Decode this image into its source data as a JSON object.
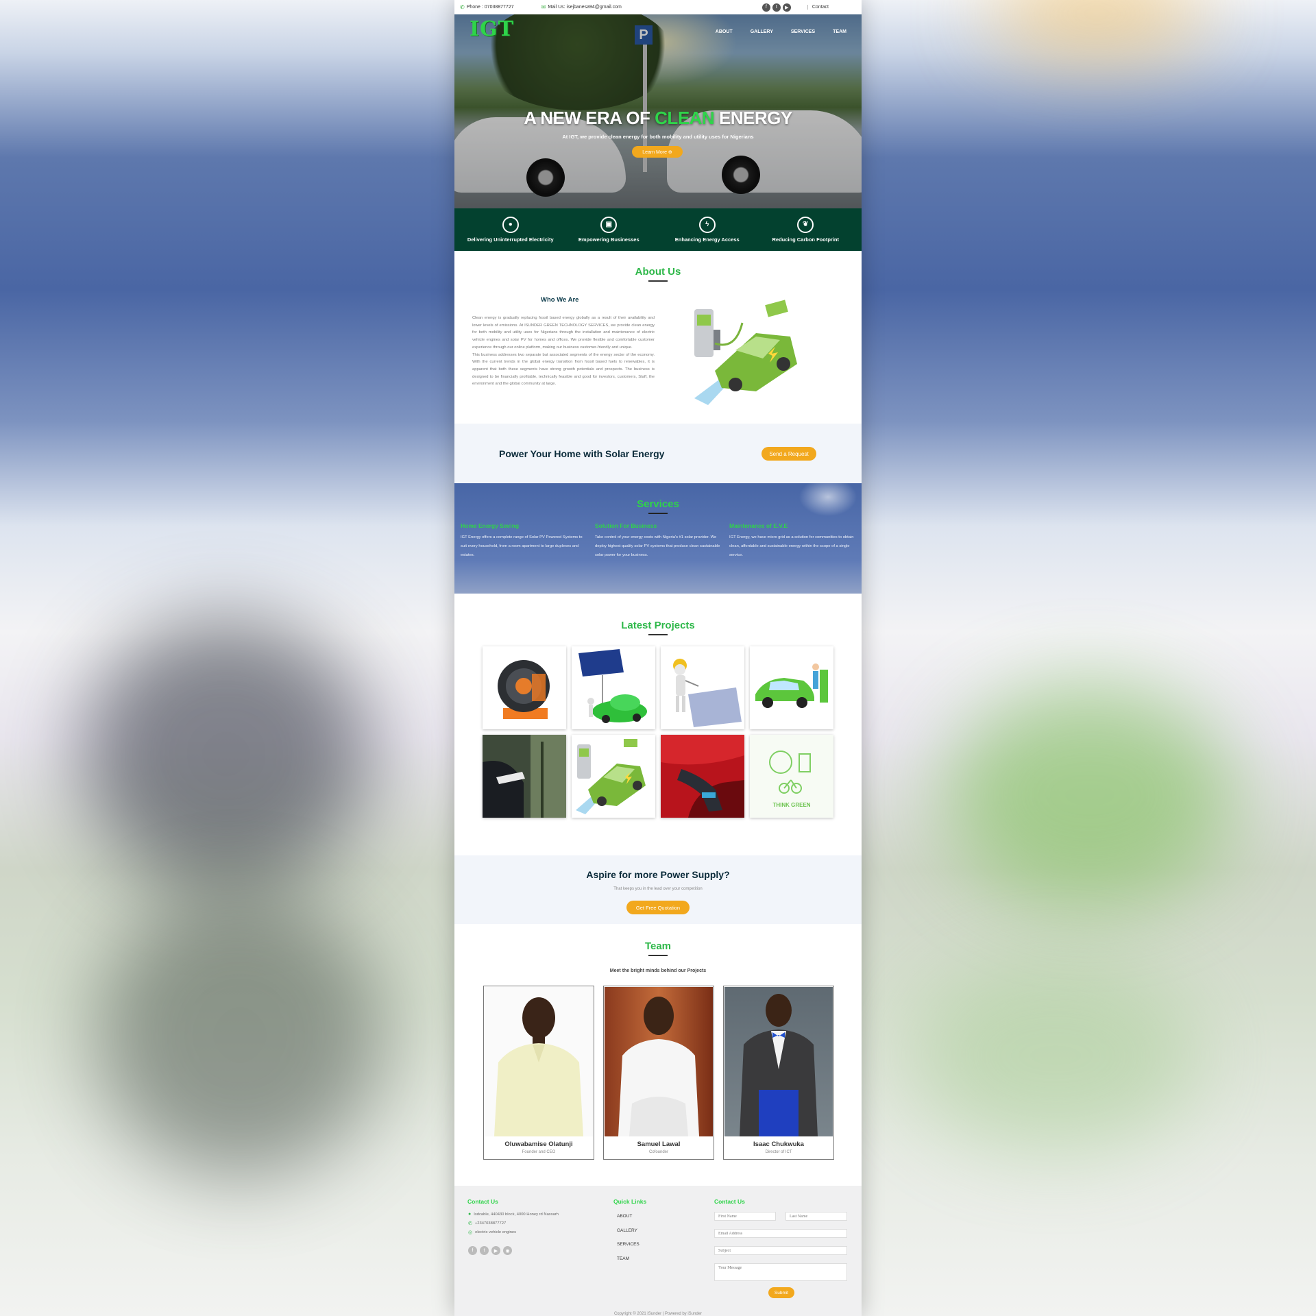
{
  "topbar": {
    "phone": "Phone : 07038877727",
    "mail": "Mail Us: isejbanesa94@gmail.com",
    "contact": "Contact",
    "socials": [
      "facebook-icon",
      "twitter-icon",
      "youtube-icon"
    ]
  },
  "header": {
    "logo": "IGT",
    "nav": [
      "ABOUT",
      "GALLERY",
      "SERVICES",
      "TEAM"
    ]
  },
  "hero": {
    "title_part1": "A NEW ERA OF ",
    "title_highlight": "CLEAN",
    "title_part2": " ENERGY",
    "subtitle": "At IGT, we provide clean energy for both mobility and utility uses for Nigerians",
    "button": "Learn More ⊕"
  },
  "features": [
    {
      "icon": "lightbulb-icon",
      "label": "Delivering Uninterrupted Electricity"
    },
    {
      "icon": "briefcase-icon",
      "label": "Empowering Businesses"
    },
    {
      "icon": "lightning-icon",
      "label": "Enhancing Energy Access"
    },
    {
      "icon": "leaf-icon",
      "label": "Reducing Carbon Footprint"
    }
  ],
  "about": {
    "heading": "About Us",
    "subheading": "Who We Are",
    "paragraph1": "Clean energy is gradually replacing fossil based energy globally as a result of their availability and lower levels of emissions. At ISUNDER GREEN TECHNOLOGY SERVICES, we provide clean energy for both mobility and utility uses for Nigerians through the installation and maintenance of electric vehicle engines and solar PV for homes and offices. We provide flexible and comfortable customer experience through our online platform, making our business customer-friendly and unique.",
    "paragraph2": "This business addresses two separate but associated segments of the energy sector of the economy. With the current trends in the global energy transition from fossil based fuels to renewables, it is apparent that both these segments have strong growth potentials and prospects. The business is designed to be financially profitable, technically feasible and good for investors, customers, Staff, the environment and the global community at large."
  },
  "solar_cta": {
    "title": "Power Your Home with Solar Energy",
    "button": "Send a Request"
  },
  "services": {
    "heading": "Services",
    "items": [
      {
        "title": "Home Energy Saving",
        "text": "IGT Energy offers a complete range of Solar PV Powered Systems to suit every household, from a room apartment to large duplexes and estates."
      },
      {
        "title": "Solution For Business",
        "text": "Take control of your energy costs with Nigeria's #1 solar provider. We deploy highest quality solar PV systems that produce clean sustainable solar power for your business."
      },
      {
        "title": "Maintenance of E.V.E",
        "text": "IGT Energy, we have micro grid as a solution for communities to obtain clean, affordable and sustainable energy within the scope of a single service."
      }
    ]
  },
  "projects": {
    "heading": "Latest Projects",
    "tiles": [
      "ev-motor-image",
      "solar-panel-car-image",
      "solar-installer-image",
      "green-car-charging-image",
      "ev-charger-plug-image",
      "ev-station-illustration",
      "red-car-charging-image",
      "think-green-image"
    ],
    "think_green_label": "THINK GREEN"
  },
  "aspire": {
    "title": "Aspire for more Power Supply?",
    "subtitle": "That keeps you in the lead over your competition",
    "button": "Get Free Quotation"
  },
  "team": {
    "heading": "Team",
    "subtitle": "Meet the bright minds behind our Projects",
    "members": [
      {
        "name": "Oluwabamise Olatunji",
        "role": "Founder and CEO"
      },
      {
        "name": "Samuel Lawal",
        "role": "Cofounder"
      },
      {
        "name": "Isaac Chukwuka",
        "role": "Director of ICT"
      }
    ]
  },
  "footer": {
    "contact_heading": "Contact Us",
    "address": "Isdcable, 440430 block, 4000 Honey rd Nassarh",
    "phone": "+2347038877727",
    "whatsapp": "electric vehicle engines",
    "links_heading": "Quick Links",
    "links": [
      "ABOUT",
      "GALLERY",
      "SERVICES",
      "TEAM"
    ],
    "form_heading": "Contact Us",
    "first_name": "First Name",
    "last_name": "Last Name",
    "email": "Email Address",
    "subject": "Subject",
    "message": "Your Message",
    "submit": "Submit",
    "copyright": "Copyright © 2021 iSunder | Powered by iSunder"
  },
  "colors": {
    "brand_green": "#2fd44a",
    "dark_green": "#03412f",
    "accent_orange": "#f2a81d",
    "services_blue": "#4866a6"
  }
}
